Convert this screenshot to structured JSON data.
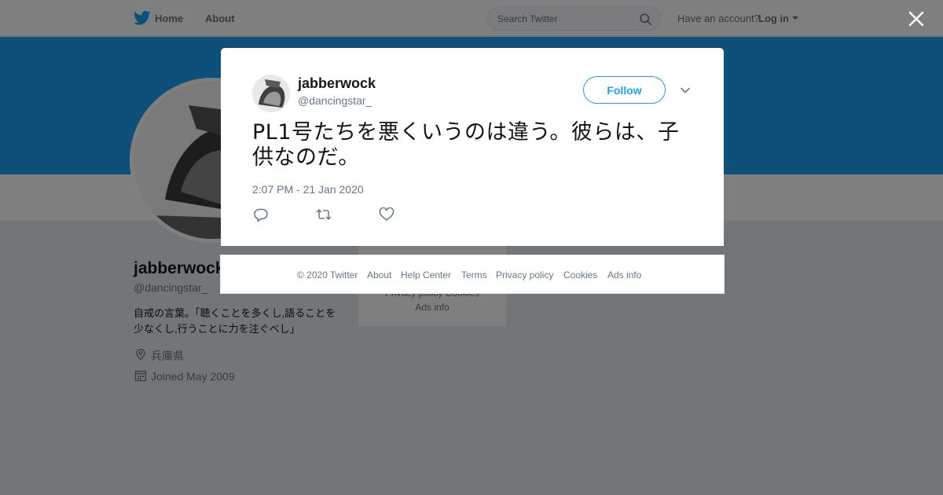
{
  "nav": {
    "home": "Home",
    "about": "About",
    "search_placeholder": "Search Twitter",
    "have_account": "Have an account?",
    "login": "Log in"
  },
  "profile": {
    "name": "jabberwock",
    "handle": "@dancingstar_",
    "bio": "自戒の言葉。「聴くことを多くし,語ることを少なくし,行うことに力を注ぐべし」",
    "location": "兵庫県",
    "joined": "Joined May 2009",
    "side_footer_line1": "Privacy policy   Cookies",
    "side_footer_line2": "Ads info"
  },
  "tweet": {
    "user_name": "jabberwock",
    "user_handle": "@dancingstar_",
    "follow_label": "Follow",
    "text": "PL1号たちを悪くいうのは違う。彼らは、子供なのだ。",
    "timestamp": "2:07 PM - 21 Jan 2020"
  },
  "footer": {
    "copyright": "© 2020 Twitter",
    "about": "About",
    "help": "Help Center",
    "terms": "Terms",
    "privacy": "Privacy policy",
    "cookies": "Cookies",
    "ads": "Ads info"
  },
  "icons": {
    "logo": "twitter-bird-icon",
    "search": "search-icon",
    "close": "close-icon",
    "caret": "chevron-down-icon",
    "reply": "reply-icon",
    "retweet": "retweet-icon",
    "like": "heart-icon",
    "location": "location-pin-icon",
    "calendar": "calendar-icon"
  },
  "colors": {
    "brand": "#1da1f2",
    "text": "#14171a",
    "muted": "#657786"
  }
}
